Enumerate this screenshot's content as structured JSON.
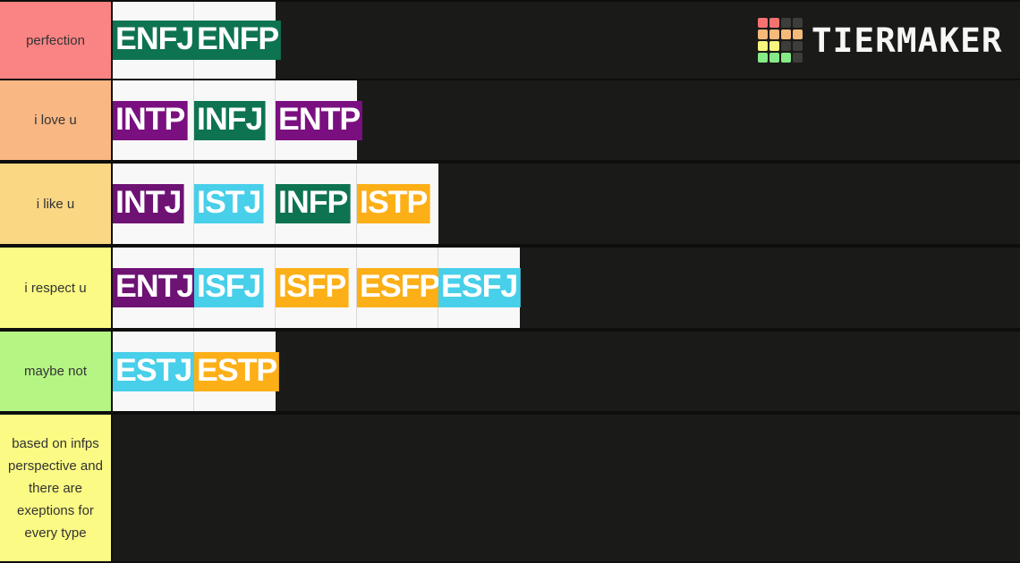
{
  "brand": {
    "name": "TIERMAKER",
    "logo_icon": "tiermaker-grid-logo",
    "grid_colors": [
      [
        "#f87171",
        "#f87171",
        "#3d3d3a",
        "#3d3d3a"
      ],
      [
        "#f5b97a",
        "#f5b97a",
        "#f5b97a",
        "#f5b97a"
      ],
      [
        "#f7f77f",
        "#f7f77f",
        "#3d3d3a",
        "#3d3d3a"
      ],
      [
        "#86ea86",
        "#86ea86",
        "#86ea86",
        "#3d3d3a"
      ]
    ]
  },
  "canvas": {
    "background": "#1a1a18",
    "tile_tray_background": "#f8f8f8"
  },
  "rows": [
    {
      "label": "perfection",
      "label_color": "#fa8383",
      "items": [
        {
          "text": "ENFJ",
          "color_class": "green",
          "color": "#0e7350"
        },
        {
          "text": "ENFP",
          "color_class": "green",
          "color": "#0e7350"
        }
      ]
    },
    {
      "label": "i love u",
      "label_color": "#f8b783",
      "items": [
        {
          "text": "INTP",
          "color_class": "purple",
          "color": "#7a1080"
        },
        {
          "text": "INFJ",
          "color_class": "green",
          "color": "#0e7350"
        },
        {
          "text": "ENTP",
          "color_class": "purple",
          "color": "#7a1080"
        }
      ]
    },
    {
      "label": "i like u",
      "label_color": "#fad783",
      "items": [
        {
          "text": "INTJ",
          "color_class": "purple-dark",
          "color": "#6e1274"
        },
        {
          "text": "ISTJ",
          "color_class": "cyan",
          "color": "#48cfe9"
        },
        {
          "text": "INFP",
          "color_class": "green",
          "color": "#0e7350"
        },
        {
          "text": "ISTP",
          "color_class": "orange",
          "color": "#fcaf17"
        }
      ]
    },
    {
      "label": "i respect u",
      "label_color": "#fafa84",
      "items": [
        {
          "text": "ENTJ",
          "color_class": "purple-dark",
          "color": "#6e1274"
        },
        {
          "text": "ISFJ",
          "color_class": "cyan",
          "color": "#48cfe9"
        },
        {
          "text": "ISFP",
          "color_class": "orange",
          "color": "#fcaf17"
        },
        {
          "text": "ESFP",
          "color_class": "orange",
          "color": "#fcaf17"
        },
        {
          "text": "ESFJ",
          "color_class": "cyan",
          "color": "#48cfe9"
        }
      ]
    },
    {
      "label": "maybe not",
      "label_color": "#b5f584",
      "items": [
        {
          "text": "ESTJ",
          "color_class": "cyan",
          "color": "#48cfe9"
        },
        {
          "text": "ESTP",
          "color_class": "orange",
          "color": "#fcaf17"
        }
      ]
    },
    {
      "label": "based on infps perspective and there are exeptions for every type",
      "label_color": "#fafa84",
      "items": []
    }
  ]
}
